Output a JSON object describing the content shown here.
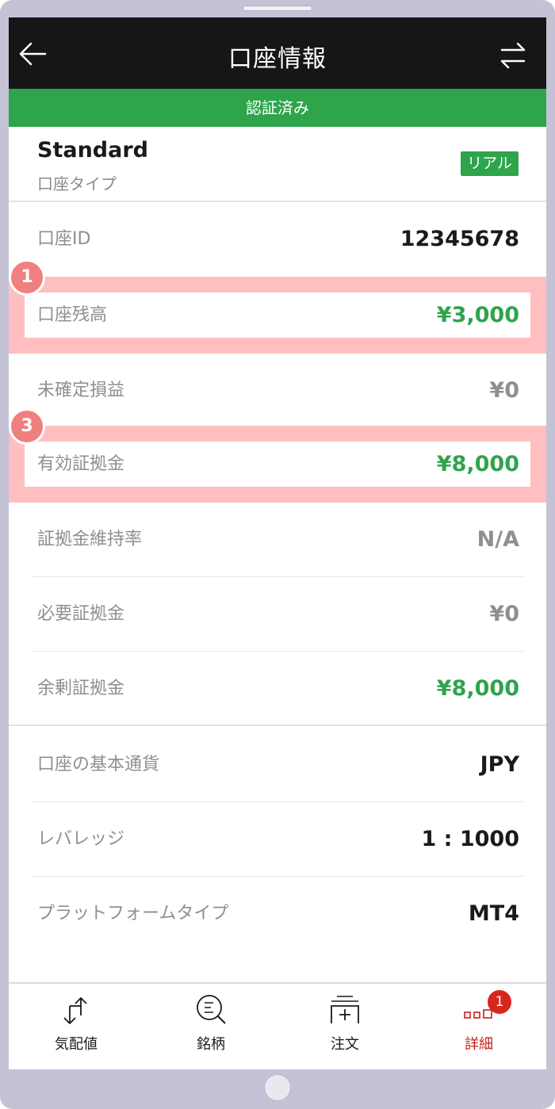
{
  "header": {
    "title": "口座情報",
    "back_icon": "arrow-left-icon",
    "swap_icon": "swap-arrows-icon"
  },
  "banner": {
    "text": "認証済み"
  },
  "account_type": {
    "name": "Standard",
    "label": "口座タイプ",
    "badge": "リアル"
  },
  "rows": {
    "account_id": {
      "label": "口座ID",
      "value": "12345678"
    },
    "balance": {
      "label": "口座残高",
      "value": "¥3,000",
      "marker": "1"
    },
    "unrealized_pl": {
      "label": "未確定損益",
      "value": "¥0"
    },
    "equity": {
      "label": "有効証拠金",
      "value": "¥8,000",
      "marker": "3"
    },
    "margin_level": {
      "label": "証拠金維持率",
      "value": "N/A"
    },
    "required_margin": {
      "label": "必要証拠金",
      "value": "¥0"
    },
    "free_margin": {
      "label": "余剰証拠金",
      "value": "¥8,000"
    },
    "base_currency": {
      "label": "口座の基本通貨",
      "value": "JPY"
    },
    "leverage": {
      "label": "レバレッジ",
      "value": "1 : 1000"
    },
    "platform": {
      "label": "プラットフォームタイプ",
      "value": "MT4"
    }
  },
  "tabbar": {
    "quotes": {
      "label": "気配値",
      "icon": "quotes-arrows-icon"
    },
    "symbols": {
      "label": "銘柄",
      "icon": "search-list-icon"
    },
    "order": {
      "label": "注文",
      "icon": "new-order-icon"
    },
    "details": {
      "label": "詳細",
      "icon": "more-dots-icon",
      "badge": "1"
    }
  },
  "colors": {
    "accent_green": "#2ea44b",
    "header_bg": "#161616",
    "highlight_bg": "#ffbfc0",
    "active_tab": "#c81e1e"
  }
}
